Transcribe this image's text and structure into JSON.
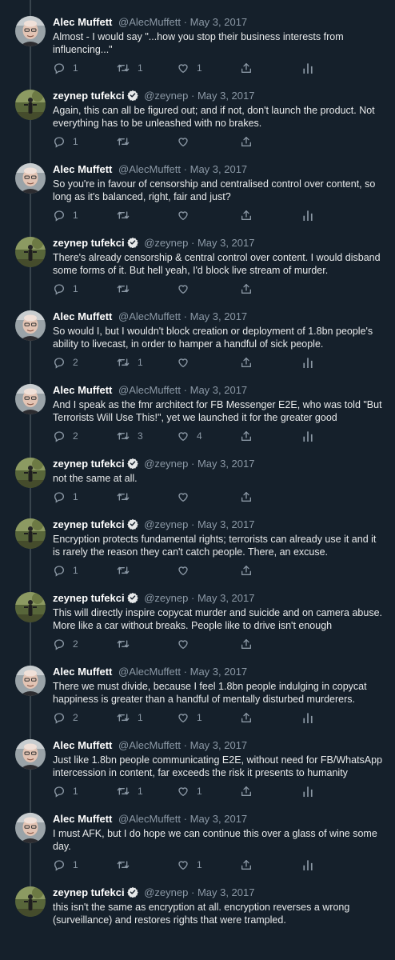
{
  "colors": {
    "background": "#15202b",
    "text": "#e7e9ea",
    "muted": "#8b98a5",
    "verified": "#1d9bf0",
    "thread_line": "#38444d"
  },
  "icons": {
    "reply": "reply-icon",
    "retweet": "retweet-icon",
    "like": "heart-icon",
    "share": "share-icon",
    "analytics": "analytics-icon",
    "verified": "verified-badge-icon"
  },
  "tweets": [
    {
      "author": "alec",
      "display_name": "Alec Muffett",
      "handle": "@AlecMuffett",
      "separator": "·",
      "date": "May 3, 2017",
      "verified": false,
      "analytics": true,
      "text": "Almost - I would say \"...how you stop their business interests from influencing...\"",
      "replies": "1",
      "retweets": "1",
      "likes": "1"
    },
    {
      "author": "zeynep",
      "display_name": "zeynep tufekci",
      "handle": "@zeynep",
      "separator": "·",
      "date": "May 3, 2017",
      "verified": true,
      "analytics": false,
      "text": "Again, this can all be figured out; and if not, don't launch the product. Not everything has to be unleashed with no brakes.",
      "replies": "1",
      "retweets": "",
      "likes": ""
    },
    {
      "author": "alec",
      "display_name": "Alec Muffett",
      "handle": "@AlecMuffett",
      "separator": "·",
      "date": "May 3, 2017",
      "verified": false,
      "analytics": true,
      "text": "So you're in favour of censorship and centralised control over content, so long as it's balanced, right, fair and just?",
      "replies": "1",
      "retweets": "",
      "likes": ""
    },
    {
      "author": "zeynep",
      "display_name": "zeynep tufekci",
      "handle": "@zeynep",
      "separator": "·",
      "date": "May 3, 2017",
      "verified": true,
      "analytics": false,
      "text": "There's already censorship & central control over content. I would disband some forms of it. But hell yeah, I'd block live stream of murder.",
      "replies": "1",
      "retweets": "",
      "likes": ""
    },
    {
      "author": "alec",
      "display_name": "Alec Muffett",
      "handle": "@AlecMuffett",
      "separator": "·",
      "date": "May 3, 2017",
      "verified": false,
      "analytics": true,
      "text": "So would I, but I wouldn't block creation or deployment of 1.8bn people's ability to livecast, in order to hamper a handful of sick people.",
      "replies": "2",
      "retweets": "1",
      "likes": ""
    },
    {
      "author": "alec",
      "display_name": "Alec Muffett",
      "handle": "@AlecMuffett",
      "separator": "·",
      "date": "May 3, 2017",
      "verified": false,
      "analytics": true,
      "text": "And I speak as the fmr architect for FB Messenger E2E, who was told \"But Terrorists Will Use This!\", yet we launched it for the greater good",
      "replies": "2",
      "retweets": "3",
      "likes": "4"
    },
    {
      "author": "zeynep",
      "display_name": "zeynep tufekci",
      "handle": "@zeynep",
      "separator": "·",
      "date": "May 3, 2017",
      "verified": true,
      "analytics": false,
      "text": "not the same at all.",
      "replies": "1",
      "retweets": "",
      "likes": ""
    },
    {
      "author": "zeynep",
      "display_name": "zeynep tufekci",
      "handle": "@zeynep",
      "separator": "·",
      "date": "May 3, 2017",
      "verified": true,
      "analytics": false,
      "text": "Encryption protects fundamental rights; terrorists can already use it and it is rarely the reason they can't catch people. There, an excuse.",
      "replies": "1",
      "retweets": "",
      "likes": ""
    },
    {
      "author": "zeynep",
      "display_name": "zeynep tufekci",
      "handle": "@zeynep",
      "separator": "·",
      "date": "May 3, 2017",
      "verified": true,
      "analytics": false,
      "text": "This will directly inspire copycat murder and suicide and on camera abuse. More like a car without breaks. People like to drive isn't enough",
      "replies": "2",
      "retweets": "",
      "likes": ""
    },
    {
      "author": "alec",
      "display_name": "Alec Muffett",
      "handle": "@AlecMuffett",
      "separator": "·",
      "date": "May 3, 2017",
      "verified": false,
      "analytics": true,
      "text": "There we must divide, because I feel 1.8bn people indulging in copycat happiness is greater than a handful of mentally disturbed murderers.",
      "replies": "2",
      "retweets": "1",
      "likes": "1"
    },
    {
      "author": "alec",
      "display_name": "Alec Muffett",
      "handle": "@AlecMuffett",
      "separator": "·",
      "date": "May 3, 2017",
      "verified": false,
      "analytics": true,
      "text": "Just like 1.8bn people communicating E2E, without need for FB/WhatsApp intercession in content, far exceeds the risk it presents to humanity",
      "replies": "1",
      "retweets": "1",
      "likes": "1"
    },
    {
      "author": "alec",
      "display_name": "Alec Muffett",
      "handle": "@AlecMuffett",
      "separator": "·",
      "date": "May 3, 2017",
      "verified": false,
      "analytics": true,
      "text": "I must AFK, but I do hope we can continue this over a glass of wine some day.",
      "replies": "1",
      "retweets": "",
      "likes": "1"
    },
    {
      "author": "zeynep",
      "display_name": "zeynep tufekci",
      "handle": "@zeynep",
      "separator": "·",
      "date": "May 3, 2017",
      "verified": true,
      "analytics": false,
      "text": "this isn't the same as encryption at all. encryption reverses a wrong (surveillance) and restores rights that were trampled.",
      "replies": "",
      "retweets": "",
      "likes": ""
    }
  ]
}
